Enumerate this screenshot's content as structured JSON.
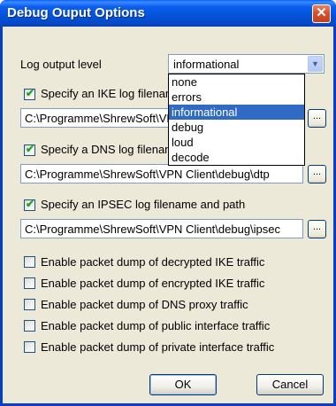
{
  "window": {
    "title": "Debug Ouput Options",
    "close_label": "✕"
  },
  "log_level": {
    "label": "Log output level",
    "selected": "informational",
    "options": [
      "none",
      "errors",
      "informational",
      "debug",
      "loud",
      "decode"
    ],
    "highlighted_index": 2
  },
  "ike": {
    "checked": true,
    "label": "Specify an IKE log filename and path",
    "path": "C:\\Programme\\ShrewSoft\\VPN Client\\debug\\ike",
    "browse_label": "..."
  },
  "dns": {
    "checked": true,
    "label": "Specify a DNS log filename and path",
    "path": "C:\\Programme\\ShrewSoft\\VPN Client\\debug\\dtp",
    "browse_label": "..."
  },
  "ipsec": {
    "checked": true,
    "label": "Specify an IPSEC log filename and path",
    "path": "C:\\Programme\\ShrewSoft\\VPN Client\\debug\\ipsec",
    "browse_label": "..."
  },
  "packet_dumps": [
    {
      "label": "Enable packet dump of decrypted IKE traffic",
      "checked": false
    },
    {
      "label": "Enable packet dump of encrypted IKE traffic",
      "checked": false
    },
    {
      "label": "Enable packet dump of DNS proxy traffic",
      "checked": false
    },
    {
      "label": "Enable packet dump of public interface traffic",
      "checked": false
    },
    {
      "label": "Enable packet dump of private interface traffic",
      "checked": false
    }
  ],
  "buttons": {
    "ok": "OK",
    "cancel": "Cancel"
  }
}
